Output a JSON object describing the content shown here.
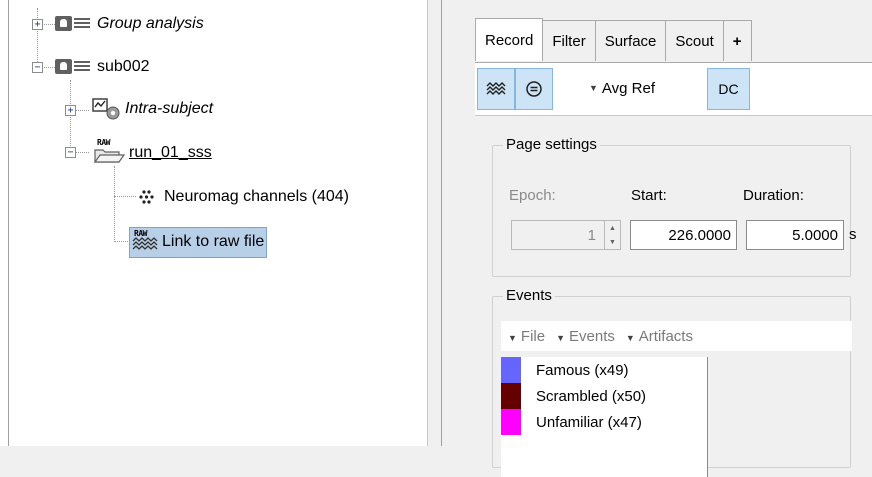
{
  "tree": {
    "items": [
      {
        "label": "Group analysis",
        "expander": "+",
        "icon": "subject-icon",
        "italic": true,
        "underline": false
      },
      {
        "label": "sub002",
        "expander": "−",
        "icon": "subject-icon",
        "italic": false,
        "underline": false
      },
      {
        "label": "Intra-subject",
        "expander": "+",
        "icon": "intra-subject-icon",
        "italic": true,
        "underline": false
      },
      {
        "label": "run_01_sss",
        "expander": "−",
        "icon": "raw-folder-icon",
        "icon_text": "RAW",
        "italic": false,
        "underline": true
      },
      {
        "label": "Neuromag channels (404)",
        "icon": "channels-icon",
        "italic": false,
        "underline": false
      },
      {
        "label": "Link to raw file",
        "icon": "raw-link-icon",
        "icon_text": "RAW",
        "italic": false,
        "underline": false,
        "selected": true
      }
    ]
  },
  "tabs": [
    {
      "label": "Record",
      "active": true
    },
    {
      "label": "Filter",
      "active": false
    },
    {
      "label": "Surface",
      "active": false
    },
    {
      "label": "Scout",
      "active": false
    },
    {
      "label": "+",
      "active": false
    }
  ],
  "toolbar": {
    "display_mode_icon": "waveform-icon",
    "montage_icon": "equal-circle-icon",
    "avg_ref_label": "Avg Ref",
    "dc_label": "DC"
  },
  "page_settings": {
    "title": "Page settings",
    "epoch_label": "Epoch:",
    "start_label": "Start:",
    "duration_label": "Duration:",
    "epoch_value": "1",
    "start_value": "226.0000",
    "duration_value": "5.0000",
    "duration_unit": "s"
  },
  "events": {
    "title": "Events",
    "menus": [
      "File",
      "Events",
      "Artifacts"
    ],
    "list": [
      {
        "label": "Famous  (x49)",
        "color": "#6666ff"
      },
      {
        "label": "Scrambled  (x50)",
        "color": "#660000"
      },
      {
        "label": "Unfamiliar  (x47)",
        "color": "#ff00ff"
      }
    ]
  },
  "colors": {
    "selection": "#b8cfe8",
    "toggle_active": "#cde4f7"
  }
}
